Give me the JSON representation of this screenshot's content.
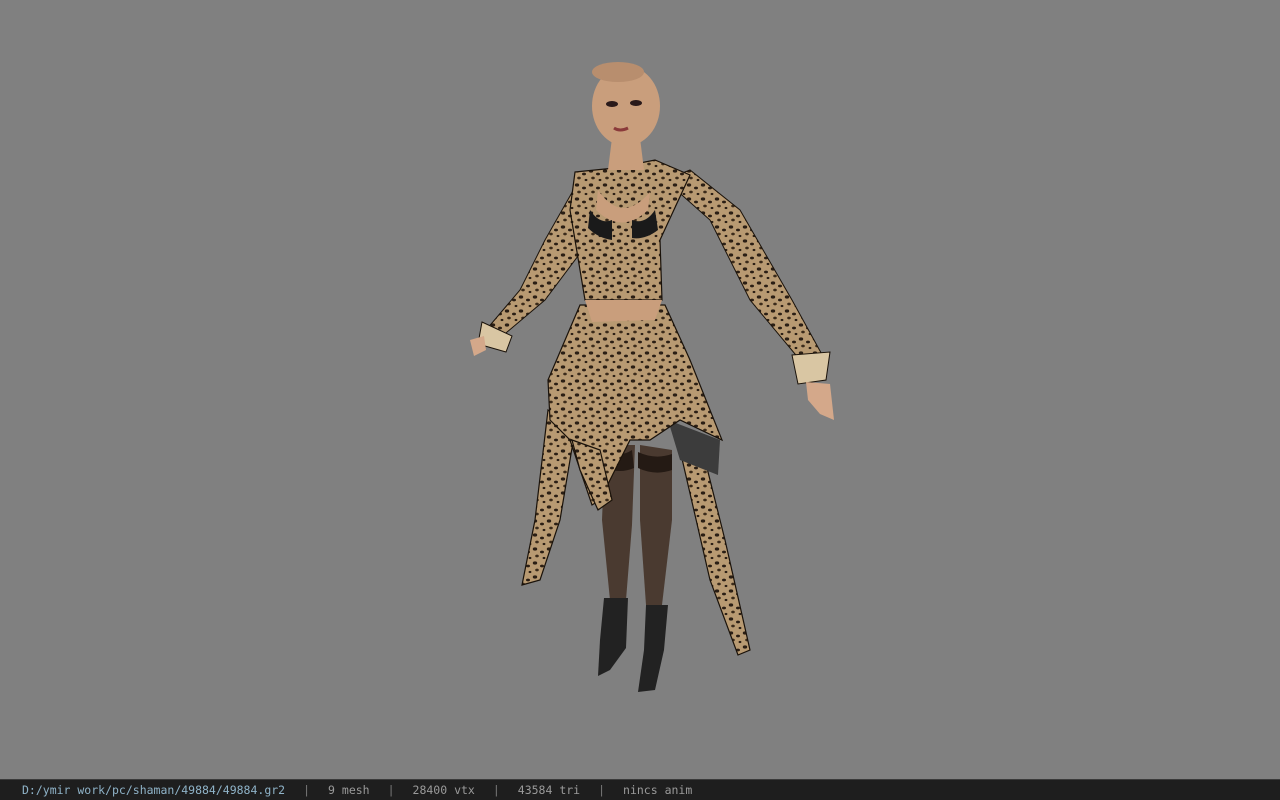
{
  "viewer": {
    "background_color": "#808080",
    "model_icon": "character-model-3d"
  },
  "statusbar": {
    "file_path": "D:/ymir work/pc/shaman/49884/49884.gr2",
    "separator": "|",
    "mesh_count": "9 mesh",
    "vertex_count": "28400 vtx",
    "triangle_count": "43584 tri",
    "anim_info": "nincs anim"
  }
}
